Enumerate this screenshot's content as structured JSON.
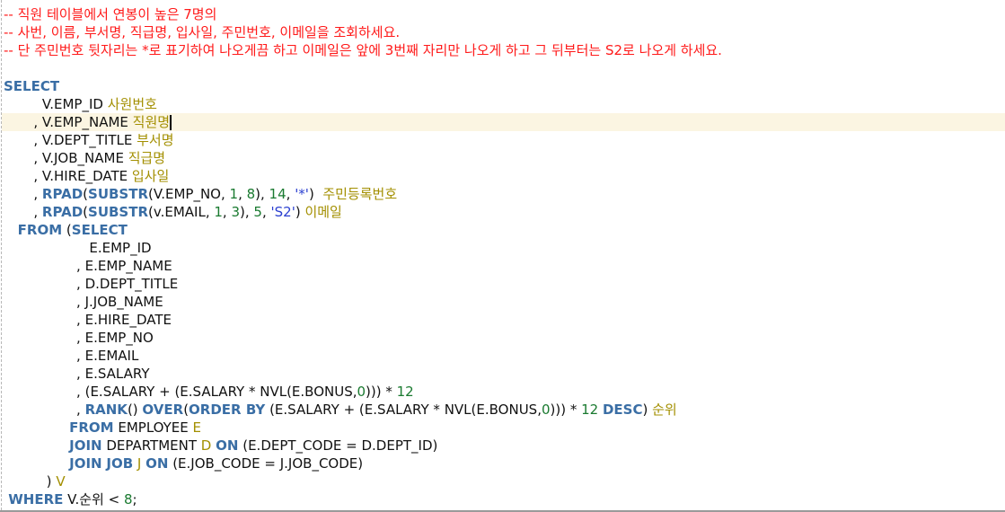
{
  "editor": {
    "current_line": 6,
    "colors": {
      "keyword": "#3a6ea5",
      "string": "#2a3fd0",
      "number": "#1a7a30",
      "alias": "#a38f00",
      "comment": "#ff1a1a",
      "text": "#111111",
      "current_line_bg": "#fbf5e2"
    },
    "lines": [
      [
        {
          "t": "-- 직원 테이블에서 연봉이 높은 7명의",
          "c": "cmt"
        }
      ],
      [
        {
          "t": "-- 사번, 이름, 부서명, 직급명, 입사일, 주민번호, 이메일을 조회하세요.",
          "c": "cmt"
        }
      ],
      [
        {
          "t": "-- 단 주민번호 뒷자리는 *로 표기하여 나오게끔 하고 이메일은 앞에 3번째 자리만 나오게 하고 그 뒤부터는 S2로 나오게 하세요.",
          "c": "cmt"
        }
      ],
      [],
      [
        {
          "t": "SELECT",
          "c": "kw"
        }
      ],
      [
        {
          "t": "         V.EMP_ID ",
          "c": "id"
        },
        {
          "t": "사원번호",
          "c": "alias"
        }
      ],
      [
        {
          "t": "       , V.EMP_NAME ",
          "c": "id"
        },
        {
          "t": "직원명",
          "c": "alias"
        }
      ],
      [
        {
          "t": "       , V.DEPT_TITLE ",
          "c": "id"
        },
        {
          "t": "부서명",
          "c": "alias"
        }
      ],
      [
        {
          "t": "       , V.JOB_NAME ",
          "c": "id"
        },
        {
          "t": "직급명",
          "c": "alias"
        }
      ],
      [
        {
          "t": "       , V.HIRE_DATE ",
          "c": "id"
        },
        {
          "t": "입사일",
          "c": "alias"
        }
      ],
      [
        {
          "t": "       , ",
          "c": "id"
        },
        {
          "t": "RPAD",
          "c": "kw"
        },
        {
          "t": "(",
          "c": "id"
        },
        {
          "t": "SUBSTR",
          "c": "kw"
        },
        {
          "t": "(V.EMP_NO, ",
          "c": "id"
        },
        {
          "t": "1",
          "c": "num"
        },
        {
          "t": ", ",
          "c": "id"
        },
        {
          "t": "8",
          "c": "num"
        },
        {
          "t": "), ",
          "c": "id"
        },
        {
          "t": "14",
          "c": "num"
        },
        {
          "t": ", ",
          "c": "id"
        },
        {
          "t": "'*'",
          "c": "str"
        },
        {
          "t": ")  ",
          "c": "id"
        },
        {
          "t": "주민등록번호",
          "c": "alias"
        }
      ],
      [
        {
          "t": "       , ",
          "c": "id"
        },
        {
          "t": "RPAD",
          "c": "kw"
        },
        {
          "t": "(",
          "c": "id"
        },
        {
          "t": "SUBSTR",
          "c": "kw"
        },
        {
          "t": "(v.EMAIL, ",
          "c": "id"
        },
        {
          "t": "1",
          "c": "num"
        },
        {
          "t": ", ",
          "c": "id"
        },
        {
          "t": "3",
          "c": "num"
        },
        {
          "t": "), ",
          "c": "id"
        },
        {
          "t": "5",
          "c": "num"
        },
        {
          "t": ", ",
          "c": "id"
        },
        {
          "t": "'S2'",
          "c": "str"
        },
        {
          "t": ") ",
          "c": "id"
        },
        {
          "t": "이메일",
          "c": "alias"
        }
      ],
      [
        {
          "t": "   FROM",
          "c": "kw"
        },
        {
          "t": " (",
          "c": "id"
        },
        {
          "t": "SELECT",
          "c": "kw"
        }
      ],
      [
        {
          "t": "                    E.EMP_ID",
          "c": "id"
        }
      ],
      [
        {
          "t": "                 , E.EMP_NAME",
          "c": "id"
        }
      ],
      [
        {
          "t": "                 , D.DEPT_TITLE",
          "c": "id"
        }
      ],
      [
        {
          "t": "                 , J.JOB_NAME",
          "c": "id"
        }
      ],
      [
        {
          "t": "                 , E.HIRE_DATE",
          "c": "id"
        }
      ],
      [
        {
          "t": "                 , E.EMP_NO",
          "c": "id"
        }
      ],
      [
        {
          "t": "                 , E.EMAIL",
          "c": "id"
        }
      ],
      [
        {
          "t": "                 , E.SALARY",
          "c": "id"
        }
      ],
      [
        {
          "t": "                 , (E.SALARY + (E.SALARY * NVL(E.BONUS,",
          "c": "id"
        },
        {
          "t": "0",
          "c": "num"
        },
        {
          "t": "))) * ",
          "c": "id"
        },
        {
          "t": "12",
          "c": "num"
        }
      ],
      [
        {
          "t": "                 , ",
          "c": "id"
        },
        {
          "t": "RANK",
          "c": "kw"
        },
        {
          "t": "() ",
          "c": "id"
        },
        {
          "t": "OVER",
          "c": "kw"
        },
        {
          "t": "(",
          "c": "id"
        },
        {
          "t": "ORDER BY",
          "c": "kw"
        },
        {
          "t": " (E.SALARY + (E.SALARY * NVL(E.BONUS,",
          "c": "id"
        },
        {
          "t": "0",
          "c": "num"
        },
        {
          "t": "))) * ",
          "c": "id"
        },
        {
          "t": "12",
          "c": "num"
        },
        {
          "t": " ",
          "c": "id"
        },
        {
          "t": "DESC",
          "c": "kw"
        },
        {
          "t": ") ",
          "c": "id"
        },
        {
          "t": "순위",
          "c": "alias"
        }
      ],
      [
        {
          "t": "              FROM",
          "c": "kw"
        },
        {
          "t": " EMPLOYEE ",
          "c": "id"
        },
        {
          "t": "E",
          "c": "alias"
        }
      ],
      [
        {
          "t": "              JOIN",
          "c": "kw"
        },
        {
          "t": " DEPARTMENT ",
          "c": "id"
        },
        {
          "t": "D",
          "c": "alias"
        },
        {
          "t": " ",
          "c": "id"
        },
        {
          "t": "ON",
          "c": "kw"
        },
        {
          "t": " (E.DEPT_CODE = D.DEPT_ID)",
          "c": "id"
        }
      ],
      [
        {
          "t": "              JOIN",
          "c": "kw"
        },
        {
          "t": " ",
          "c": "id"
        },
        {
          "t": "JOB",
          "c": "kw"
        },
        {
          "t": " ",
          "c": "id"
        },
        {
          "t": "J",
          "c": "alias"
        },
        {
          "t": " ",
          "c": "id"
        },
        {
          "t": "ON",
          "c": "kw"
        },
        {
          "t": " (E.JOB_CODE = J.JOB_CODE)",
          "c": "id"
        }
      ],
      [
        {
          "t": "          ) ",
          "c": "id"
        },
        {
          "t": "V",
          "c": "alias"
        }
      ],
      [
        {
          "t": " WHERE",
          "c": "kw"
        },
        {
          "t": " V.순위 < ",
          "c": "id"
        },
        {
          "t": "8",
          "c": "num"
        },
        {
          "t": ";",
          "c": "id"
        }
      ]
    ]
  }
}
